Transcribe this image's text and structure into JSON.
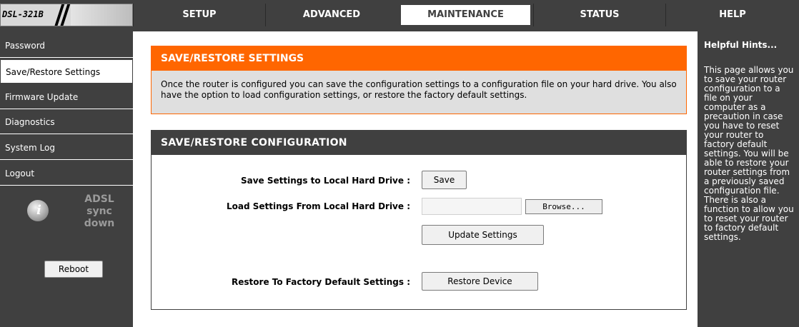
{
  "header": {
    "logo_text": "DSL-321B",
    "tabs": [
      {
        "label": "SETUP",
        "active": false
      },
      {
        "label": "ADVANCED",
        "active": false
      },
      {
        "label": "MAINTENANCE",
        "active": true
      },
      {
        "label": "STATUS",
        "active": false
      },
      {
        "label": "HELP",
        "active": false
      }
    ]
  },
  "sidebar": {
    "items": [
      {
        "label": "Password",
        "active": false
      },
      {
        "label": "Save/Restore Settings",
        "active": true
      },
      {
        "label": "Firmware Update",
        "active": false
      },
      {
        "label": "Diagnostics",
        "active": false
      },
      {
        "label": "System Log",
        "active": false
      },
      {
        "label": "Logout",
        "active": false
      }
    ],
    "status_lines": [
      "ADSL",
      "sync",
      "down"
    ],
    "reboot_label": "Reboot"
  },
  "main": {
    "intro": {
      "title": "SAVE/RESTORE SETTINGS",
      "text": "Once the router is configured you can save the configuration settings to a configuration file on your hard drive. You also have the option to load configuration settings, or restore the factory default settings."
    },
    "config": {
      "title": "SAVE/RESTORE CONFIGURATION",
      "save_label": "Save Settings to Local Hard Drive :",
      "save_button": "Save",
      "load_label": "Load Settings From Local Hard Drive :",
      "file_value": "",
      "browse_button": "Browse...",
      "update_button": "Update Settings",
      "restore_label": "Restore To Factory Default Settings :",
      "restore_button": "Restore Device"
    }
  },
  "hints": {
    "title": "Helpful Hints...",
    "text": "This page allows you to save your router configuration to a file on your computer as a precaution in case you have to reset your router to factory default settings. You will be able to restore your router settings from a previously saved configuration file. There is also a function to allow you to reset your router to factory default settings."
  },
  "colors": {
    "accent_orange": "#ff6600",
    "dark_gray": "#404040",
    "panel_gray": "#dfdfdf"
  }
}
